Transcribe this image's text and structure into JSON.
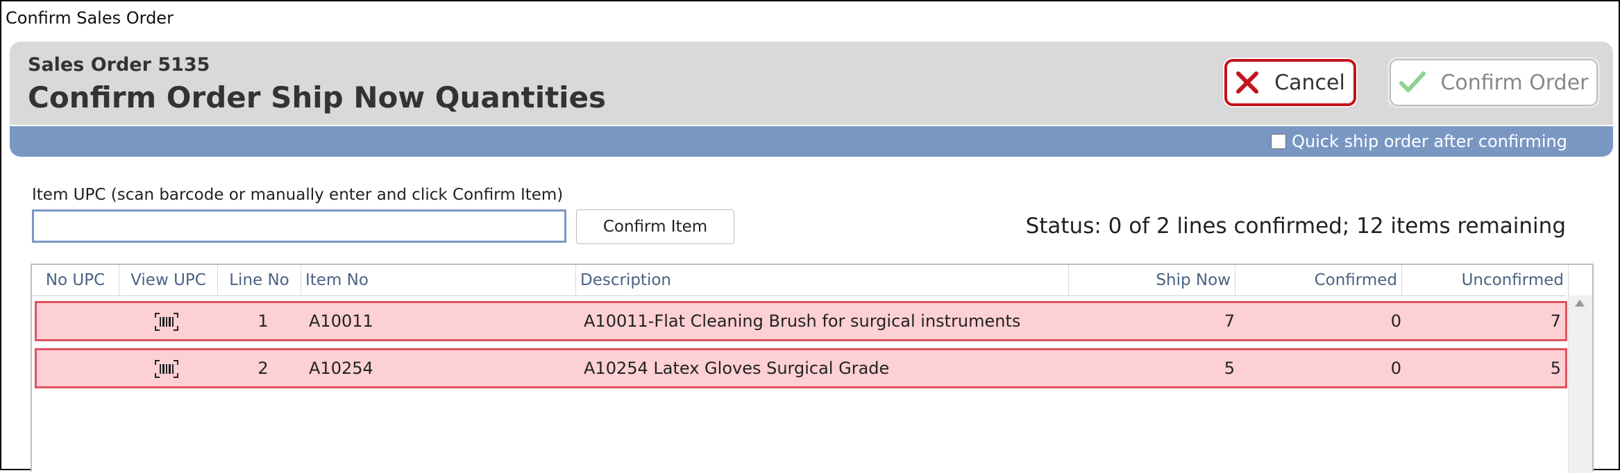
{
  "window": {
    "title": "Confirm Sales Order"
  },
  "header": {
    "order_label": "Sales Order 5135",
    "title": "Confirm Order Ship Now Quantities",
    "cancel_label": "Cancel",
    "confirm_label": "Confirm Order"
  },
  "options": {
    "quick_ship_label": "Quick ship order after confirming",
    "quick_ship_checked": false
  },
  "scan": {
    "label": "Item UPC (scan barcode or manually enter and click Confirm Item)",
    "value": "",
    "placeholder": "",
    "button_label": "Confirm Item"
  },
  "status": {
    "text": "Status: 0 of 2 lines confirmed; 12 items remaining"
  },
  "table": {
    "columns": [
      "No UPC",
      "View UPC",
      "Line No",
      "Item No",
      "Description",
      "Ship Now",
      "Confirmed",
      "Unconfirmed"
    ],
    "rows": [
      {
        "line_no": "1",
        "item_no": "A10011",
        "description": "A10011-Flat Cleaning Brush for surgical instruments",
        "ship_now": "7",
        "confirmed": "0",
        "unconfirmed": "7"
      },
      {
        "line_no": "2",
        "item_no": "A10254",
        "description": "A10254 Latex Gloves Surgical Grade",
        "ship_now": "5",
        "confirmed": "0",
        "unconfirmed": "5"
      }
    ]
  },
  "icons": {
    "cancel": "close-icon",
    "confirm": "checkmark-icon",
    "view_upc": "barcode-icon"
  },
  "colors": {
    "header_bg": "#d9d9d9",
    "bar_blue": "#7a97c4",
    "cancel_red": "#c4141c",
    "confirm_green": "#8ed18e",
    "row_unconfirmed_bg": "#fdd0d4",
    "row_unconfirmed_border": "#e0515c"
  }
}
